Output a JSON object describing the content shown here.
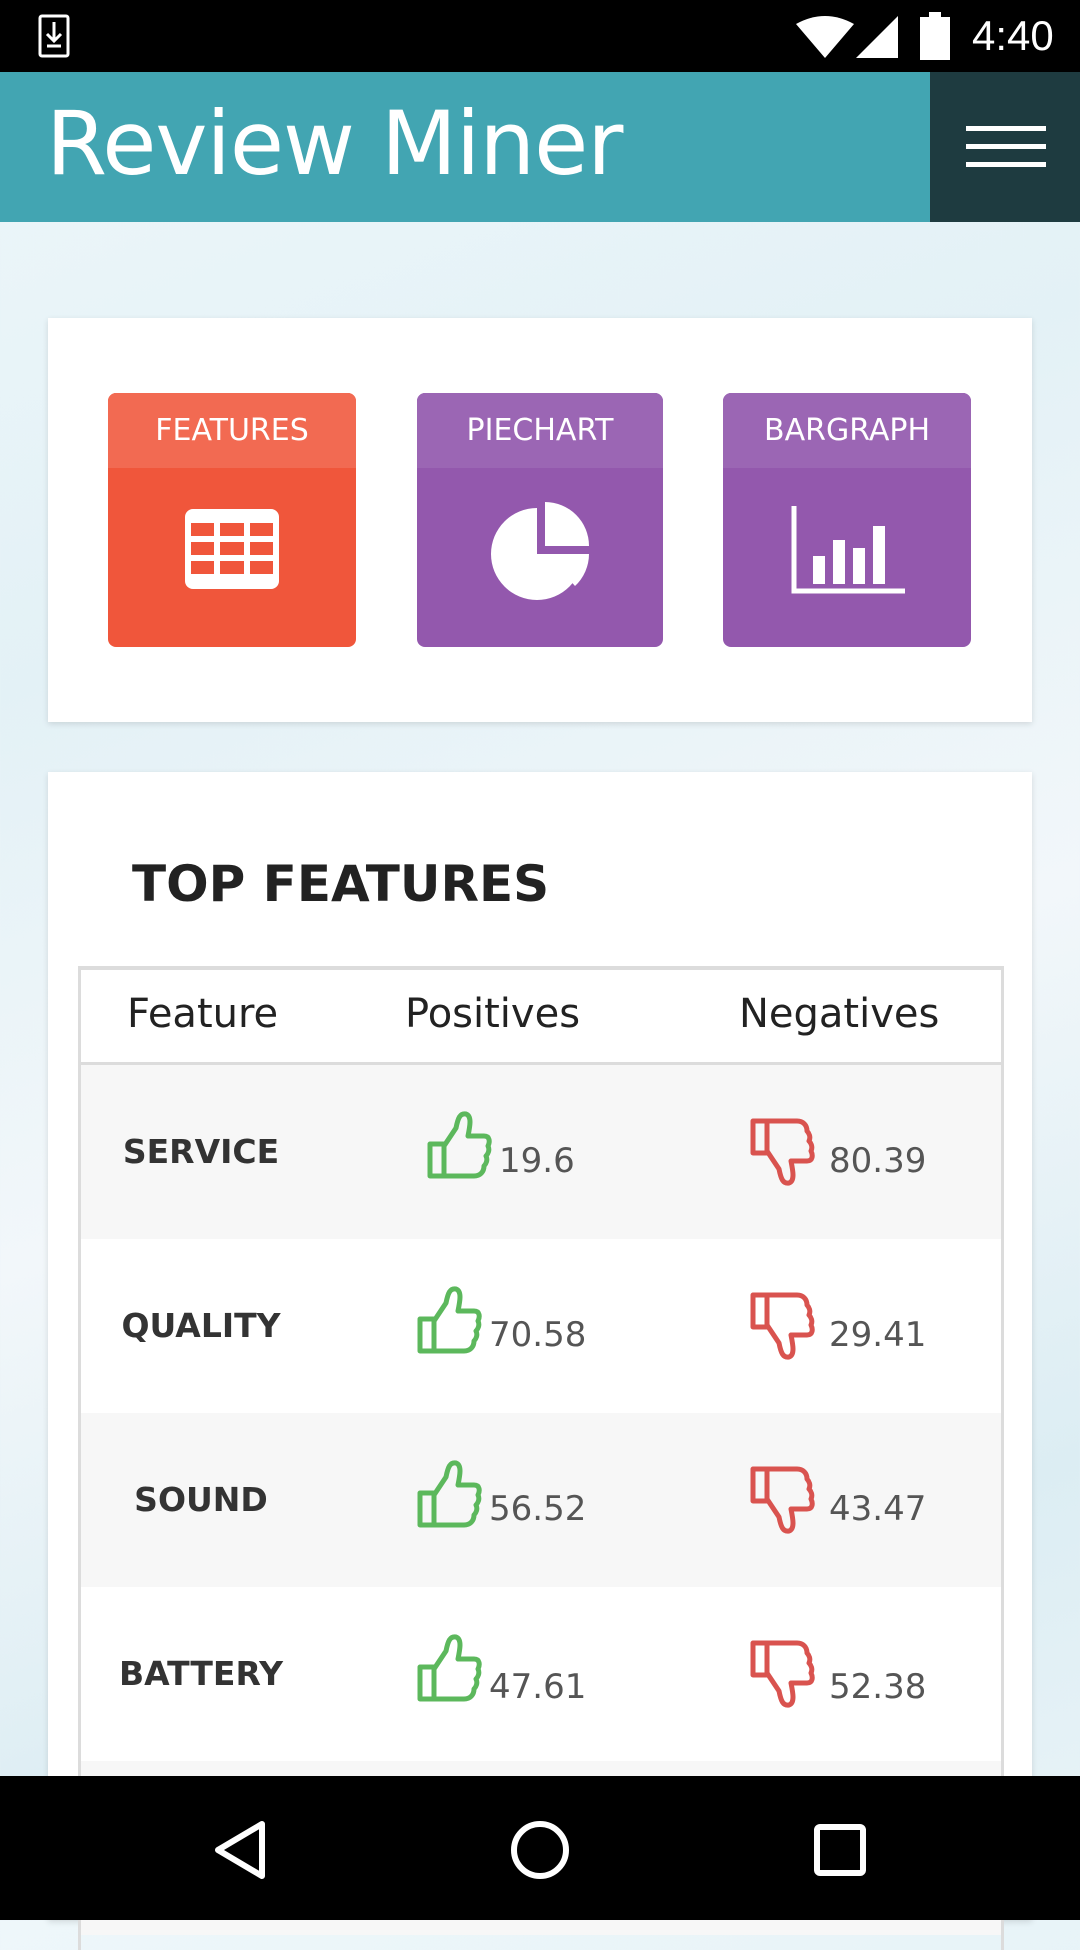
{
  "status_bar": {
    "time": "4:40",
    "icons": [
      "download-icon",
      "wifi-icon",
      "signal-icon",
      "battery-icon"
    ]
  },
  "app_bar": {
    "title": "Review Miner",
    "menu_icon": "hamburger-menu-icon",
    "color": "#42a5b2",
    "menu_bg": "#1e3b40"
  },
  "tiles": [
    {
      "label": "FEATURES",
      "icon": "table-grid-icon",
      "color": "#f0563b"
    },
    {
      "label": "PIECHART",
      "icon": "pie-chart-icon",
      "color": "#9358ad"
    },
    {
      "label": "BARGRAPH",
      "icon": "bar-graph-icon",
      "color": "#9358ad"
    }
  ],
  "top_features": {
    "title": "TOP FEATURES",
    "columns": [
      "Feature",
      "Positives",
      "Negatives"
    ],
    "rows": [
      {
        "feature": "SERVICE",
        "positives": "19.6",
        "negatives": "80.39"
      },
      {
        "feature": "QUALITY",
        "positives": "70.58",
        "negatives": "29.41"
      },
      {
        "feature": "SOUND",
        "positives": "56.52",
        "negatives": "43.47"
      },
      {
        "feature": "BATTERY",
        "positives": "47.61",
        "negatives": "52.38"
      }
    ],
    "positive_color": "#5cb85c",
    "negative_color": "#d9534f"
  },
  "nav_bar": {
    "icons": [
      "back-triangle-icon",
      "home-circle-icon",
      "recents-square-icon"
    ]
  }
}
